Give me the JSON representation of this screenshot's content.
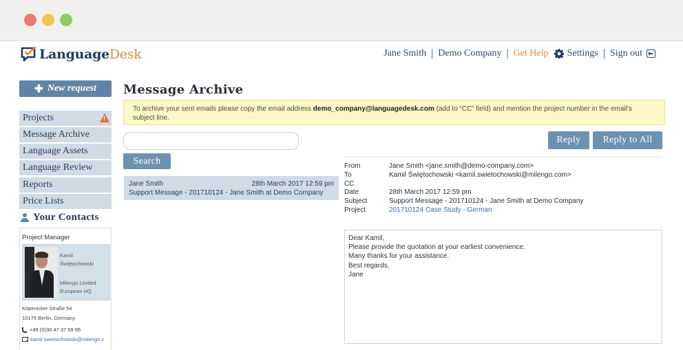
{
  "window": {
    "controls": [
      "close",
      "minimize",
      "maximize"
    ]
  },
  "brand": {
    "logo_bold": "Language",
    "logo_light": "Desk",
    "icon": "chat-check-icon"
  },
  "topnav": {
    "user": "Jane Smith",
    "company": "Demo Company",
    "help": "Get Help",
    "settings": "Settings",
    "signout": "Sign out"
  },
  "sidebar": {
    "new_request": "New request",
    "items": [
      {
        "label": "Projects",
        "warning": true
      },
      {
        "label": "Message Archive"
      },
      {
        "label": "Language Assets"
      },
      {
        "label": "Language Review"
      },
      {
        "label": "Reports"
      },
      {
        "label": "Price Lists"
      }
    ],
    "warning_glyph": "!",
    "contacts_title": "Your Contacts",
    "contact": {
      "role": "Project Manager",
      "first_name": "Kamil",
      "last_name": "Świętochowski",
      "company_line1": "Milengo Limited",
      "company_line2": "European HQ",
      "street": "Köpenicker Straße 54",
      "city": "10179 Berlin, Germany",
      "phone": "+49 (0)30 47 37 59 95",
      "email": "kamil.swietochowski@milengo.c"
    }
  },
  "main": {
    "title": "Message Archive",
    "notice_prefix": "To archive your sent emails please copy the email address ",
    "notice_email": "demo_company@languagedesk.com",
    "notice_suffix": " (add to “CC” field) and mention the project number in the email's subject line.",
    "search_placeholder": "",
    "search_button": "Search",
    "messages": [
      {
        "sender": "Jane Smith",
        "date": "28th March 2017 12:59 pm",
        "subject": "Support Message - 201710124 - Jane Smith at Demo Company"
      }
    ],
    "reply": "Reply",
    "reply_all": "Reply to All",
    "detail": {
      "labels": {
        "from": "From",
        "to": "To",
        "cc": "CC",
        "date": "Date",
        "subject": "Subject",
        "project": "Project"
      },
      "from": "Jane Smith <jane.smith@demo-company.com>",
      "to": "Kamil Świętochowski <kamil.swietochowski@milengo.com>",
      "cc": "",
      "date": "28th March 2017 12:59 pm",
      "subject": "Support Message - 201710124 - Jane Smith at Demo Company",
      "project": "201710124 Case Study - German",
      "body": [
        "Dear Kamil,",
        "Please provide the quotation at your earliest convenience.",
        "Many thanks for your assistance.",
        "Best regards,",
        "Jane"
      ]
    }
  },
  "colors": {
    "accent": "#5f84a8",
    "brand_dark": "#23395d",
    "brand_orange": "#e58a3a",
    "sidebar_bg": "#cfdbe5",
    "notice_bg": "#fbf7c6",
    "warning": "#e86f2c"
  }
}
